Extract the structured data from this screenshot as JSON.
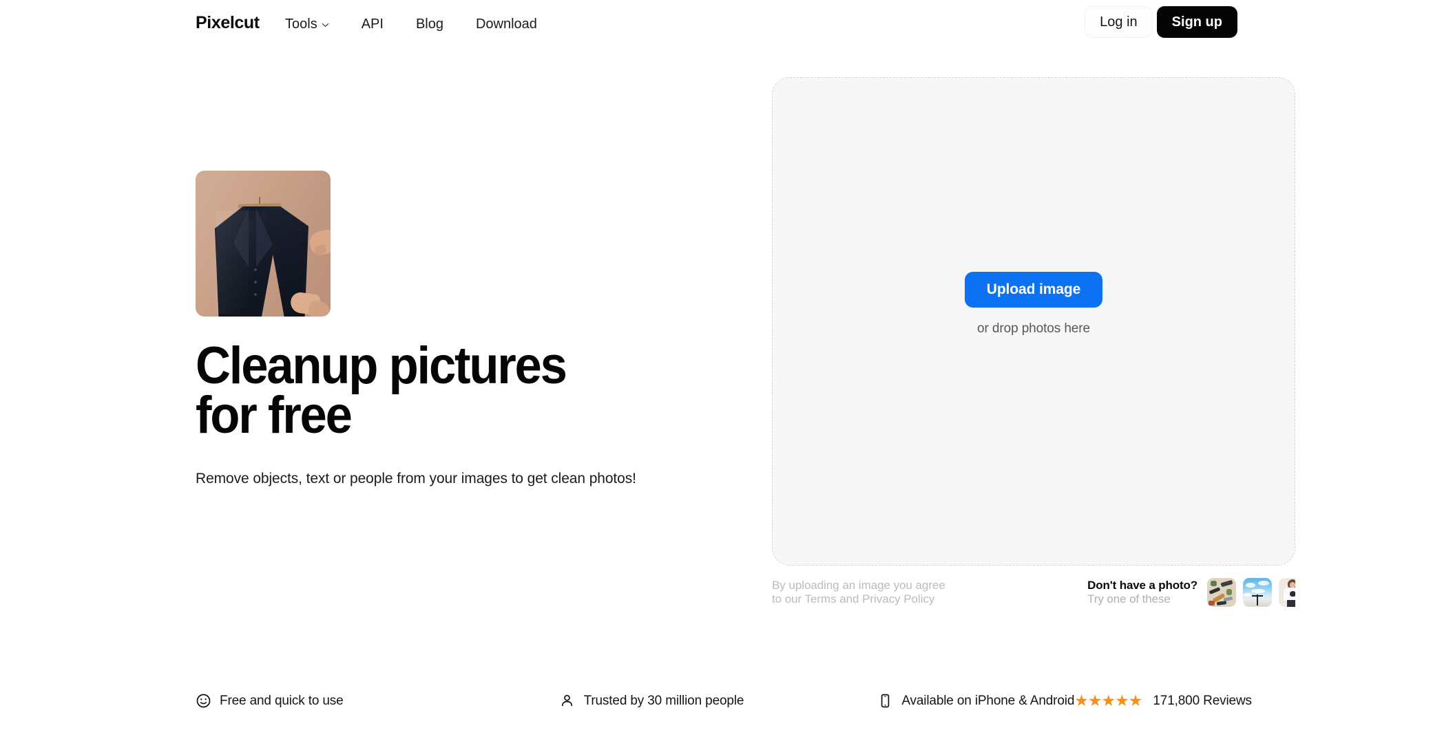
{
  "header": {
    "brand": "Pixelcut",
    "nav": [
      {
        "label": "Tools",
        "icon": "chevron-down-icon",
        "has_dropdown": true
      },
      {
        "label": "API",
        "has_dropdown": false
      },
      {
        "label": "Blog",
        "has_dropdown": false
      },
      {
        "label": "Download",
        "has_dropdown": false
      }
    ],
    "login_label": "Log in",
    "signup_label": "Sign up"
  },
  "hero": {
    "image_alt": "navy blazer on wooden hanger held by hand",
    "title": "Cleanup pictures for free",
    "subtitle": "Remove objects, text or people from your images to get clean photos!"
  },
  "upload": {
    "button_label": "Upload image",
    "drop_hint": "or drop photos here",
    "terms_line1": "By uploading an image you agree",
    "terms_line2_prefix": "to our ",
    "terms_link": "Terms",
    "terms_and": " and ",
    "privacy_link": "Privacy Policy"
  },
  "samples": {
    "title": "Don't have a photo?",
    "subtitle": "Try one of these",
    "items": [
      {
        "name": "sample-flatlay-objects"
      },
      {
        "name": "sample-sky-beach"
      },
      {
        "name": "sample-person-tshirt"
      }
    ]
  },
  "features": [
    {
      "icon": "smiley-icon",
      "label": "Free and quick to use"
    },
    {
      "icon": "person-icon",
      "label": "Trusted by 30 million people"
    },
    {
      "icon": "phone-icon",
      "label": "Available on iPhone & Android"
    }
  ],
  "rating": {
    "stars": "★★★★★",
    "reviews_label": "171,800 Reviews"
  },
  "colors": {
    "accent_blue": "#0d72f2",
    "star_orange": "#f5901f",
    "signup_black": "#050505",
    "dropzone_bg": "#f7f7f7",
    "dropzone_border": "#d6d6d6"
  }
}
